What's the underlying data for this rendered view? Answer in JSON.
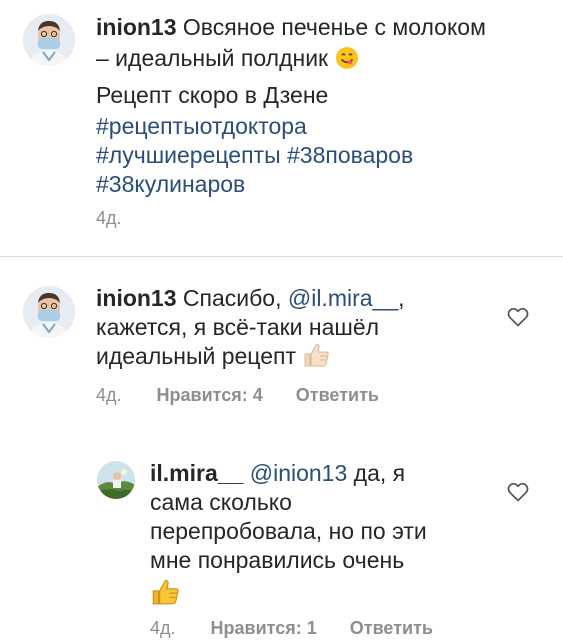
{
  "post": {
    "username": "inion13",
    "caption_line1": "Овсяное печенье с молоком",
    "caption_line2": "– идеальный полдник",
    "caption_emoji": "yum-face-emoji",
    "caption_line3": "Рецепт скоро в Дзене",
    "hashtag1": "#рецептыотдоктора",
    "hashtag2": "#лучшиерецепты",
    "hashtag3": "#38поваров",
    "hashtag4": "#38кулинаров",
    "time": "4д."
  },
  "comment1": {
    "username": "inion13",
    "text_part1": "Спасибо,",
    "mention": "@il.mira__",
    "text_part2": ",",
    "line2": "кажется, я всё-таки нашёл",
    "line3": "идеальный рецепт",
    "emoji": "thumbs-up-light-emoji",
    "time": "4д.",
    "likes": "Нравится: 4",
    "reply": "Ответить"
  },
  "comment2": {
    "username": "il.mira__",
    "mention": "@inion13",
    "text_part1": "да, я",
    "line2": "сама сколько",
    "line3": "перепробовала, но по эти",
    "line4": "мне понравились очень",
    "emoji": "thumbs-up-emoji",
    "time": "4д.",
    "likes": "Нравится: 1",
    "reply": "Ответить"
  },
  "colors": {
    "hashtag": "#2a4d7a",
    "meta": "#8e8e8e",
    "text": "#262626",
    "divider": "#dbdbdb"
  }
}
